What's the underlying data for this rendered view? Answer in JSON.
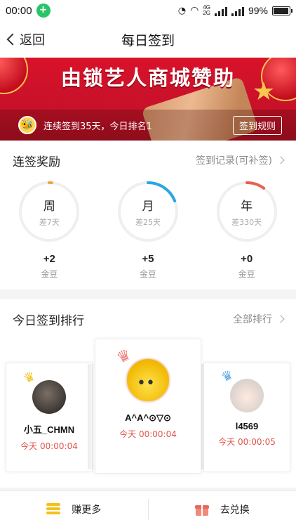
{
  "status_bar": {
    "time": "00:00",
    "app_badge": "+",
    "network_top": "4G",
    "network_bottom": "2G",
    "battery": "99%",
    "battery_level": 0.99
  },
  "nav": {
    "back_label": "返回",
    "title": "每日签到"
  },
  "banner": {
    "title": "由锁艺人商城赞助",
    "streak_text": "连续签到35天，今日排名1",
    "rules_button": "签到规则"
  },
  "rewards": {
    "title": "连签奖励",
    "history_link": "签到记录(可补签)",
    "items": [
      {
        "period": "周",
        "remaining": "差7天",
        "bonus": "+2",
        "unit": "金豆",
        "progress": 0.0,
        "color": "#f0a63c"
      },
      {
        "period": "月",
        "remaining": "差25天",
        "bonus": "+5",
        "unit": "金豆",
        "progress": 0.19,
        "color": "#2aa6e0"
      },
      {
        "period": "年",
        "remaining": "差330天",
        "bonus": "+0",
        "unit": "金豆",
        "progress": 0.1,
        "color": "#e8634e"
      }
    ]
  },
  "ranking": {
    "title": "今日签到排行",
    "all_link": "全部排行",
    "users": [
      {
        "name": "小五_CHMN",
        "time": "今天 00:00:04",
        "place": 2,
        "crown_color": "#f3c21c"
      },
      {
        "name": "A^A^⊙▽⊙",
        "time": "今天 00:00:04",
        "place": 1,
        "crown_color": "#f08080"
      },
      {
        "name": "l4569",
        "time": "今天 00:00:05",
        "place": 3,
        "crown_color": "#5ba6e6"
      }
    ]
  },
  "bottom": {
    "earn_label": "赚更多",
    "exchange_label": "去兑换"
  }
}
